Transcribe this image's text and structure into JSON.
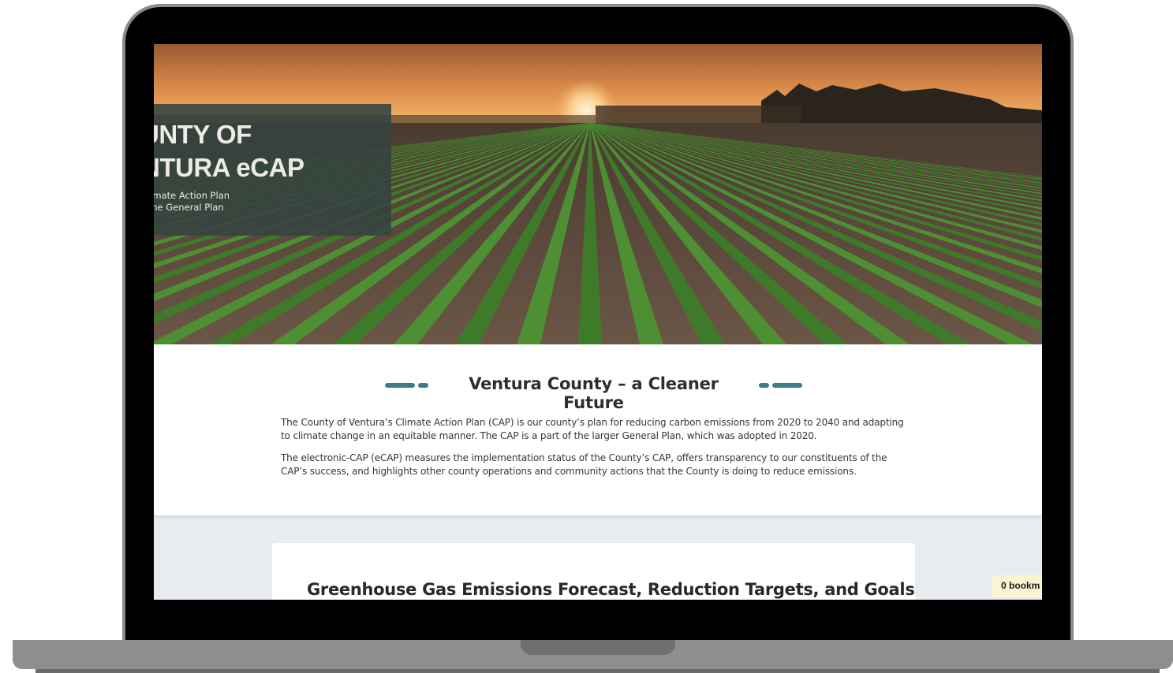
{
  "hero": {
    "title_line_1": "UNTY OF",
    "title_line_2": "NTURA eCAP",
    "subtitle_line_1": "ronic Climate Action Plan",
    "subtitle_line_2": "of the General Plan",
    "image": "farm-field-sunset"
  },
  "intro": {
    "heading": "Ventura County – a Cleaner Future",
    "paragraphs": [
      "The County of Ventura’s Climate Action Plan (CAP) is our county’s plan for reducing carbon emissions from 2020 to 2040 and adapting to climate change in an equitable manner. The CAP is a part of the larger General Plan, which was adopted in 2020.",
      "The electronic-CAP (eCAP) measures the implementation status of the County’s CAP, offers transparency to our constituents of the CAP’s success, and highlights other county operations and community actions that the County is doing to reduce emissions."
    ]
  },
  "section": {
    "card_title": "Greenhouse Gas Emissions Forecast, Reduction Targets, and Goals"
  },
  "bookmark": {
    "label": "0 bookm"
  },
  "colors": {
    "accent": "#3d7c86",
    "overlay": "#344240",
    "page_background": "#e8ebf0",
    "badge": "#fbf4d3"
  }
}
